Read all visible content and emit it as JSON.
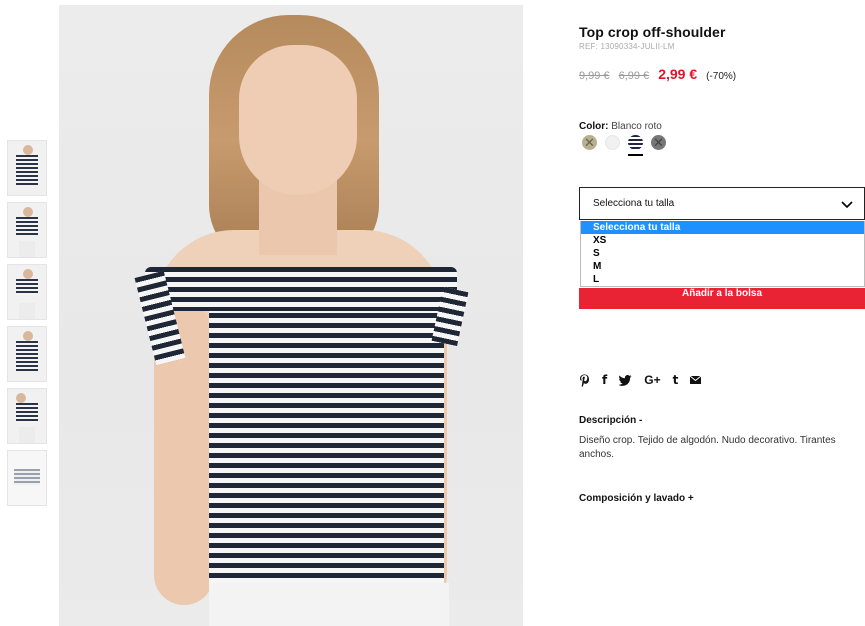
{
  "product": {
    "title": "Top crop off-shoulder",
    "ref": "REF: 13090334-JULII-LM",
    "price_original": "9,99 €",
    "price_previous": "6,99 €",
    "price_current": "2,99 €",
    "discount": "(-70%)",
    "price_color": "#e0152a"
  },
  "color": {
    "label": "Color:",
    "value": "Blanco roto",
    "swatches": [
      {
        "name": "khaki",
        "unavailable": true
      },
      {
        "name": "white",
        "unavailable": false
      },
      {
        "name": "navy-stripe",
        "unavailable": false,
        "selected": true
      },
      {
        "name": "grey",
        "unavailable": true
      }
    ]
  },
  "size": {
    "placeholder": "Selecciona tu talla",
    "options": [
      "Selecciona tu talla",
      "XS",
      "S",
      "M",
      "L"
    ],
    "highlighted": "Selecciona tu talla"
  },
  "add_to_bag": "Añadir a la bolsa",
  "social": [
    {
      "icon": "pinterest-icon",
      "glyph": "𝒫"
    },
    {
      "icon": "facebook-icon",
      "glyph": "f"
    },
    {
      "icon": "twitter-icon",
      "glyph": "🐦"
    },
    {
      "icon": "google-plus-icon",
      "glyph": "G+"
    },
    {
      "icon": "tumblr-icon",
      "glyph": "t"
    },
    {
      "icon": "email-icon",
      "glyph": "✉"
    }
  ],
  "description": {
    "heading": "Descripción  -",
    "text": "Diseño crop. Tejido de algodón. Nudo decorativo. Tirantes anchos."
  },
  "composition": {
    "heading": "Composición y lavado  +"
  },
  "accent_color": "#ea2334",
  "dropdown_highlight": "#1e90ff"
}
